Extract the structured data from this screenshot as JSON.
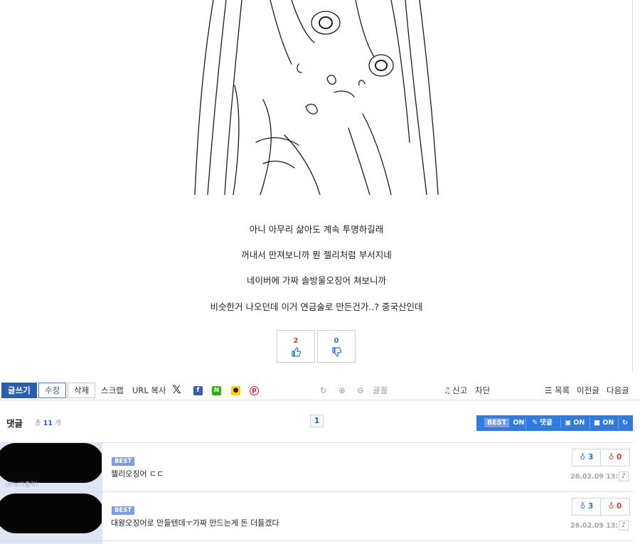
{
  "post": {
    "lines": [
      "아니 아무리 삶아도 계속 투명하길래",
      "꺼내서 만져보니까 뭔 젤리처럼 부서지네",
      "네이버에 가짜 솔방울오징어 쳐보니까",
      "비슷한거 나오던데 이거 연금술로 만든건가..? 중국산인데"
    ],
    "upvotes": "2",
    "downvotes": "0"
  },
  "toolbar": {
    "write": "글쓰기",
    "edit": "수정",
    "delete": "삭제",
    "scrap": "스크랩",
    "url_copy": "URL 복사",
    "naver": "N",
    "font": "글꼴",
    "report": "신고",
    "block": "차단",
    "list": "목록",
    "prev": "이전글",
    "next": "다음글"
  },
  "comments_header": {
    "title": "댓글",
    "count_prefix": "총",
    "count": "11",
    "count_suffix": "개",
    "page": "1",
    "best": "BEST",
    "best_state": "ON",
    "reply": "댓글",
    "image_state": "ON",
    "video_state": "ON"
  },
  "comments": [
    {
      "author_note": "(IP보기클릭)",
      "badge": "BEST",
      "text": "젤리오징어 ㄷㄷ",
      "up": "3",
      "down": "0",
      "date": "26.02.09 13:48"
    },
    {
      "badge": "BEST",
      "text": "대왕오징어로 만들텐데ㅜ가짜 만드는게 돈 더들겠다",
      "up": "3",
      "down": "0",
      "date": "26.02.09 13:49"
    }
  ],
  "colors": {
    "accent": "#2a5fb0",
    "bar": "#2f7be0",
    "best": "#7e9ae8",
    "down": "#d43b3b"
  }
}
